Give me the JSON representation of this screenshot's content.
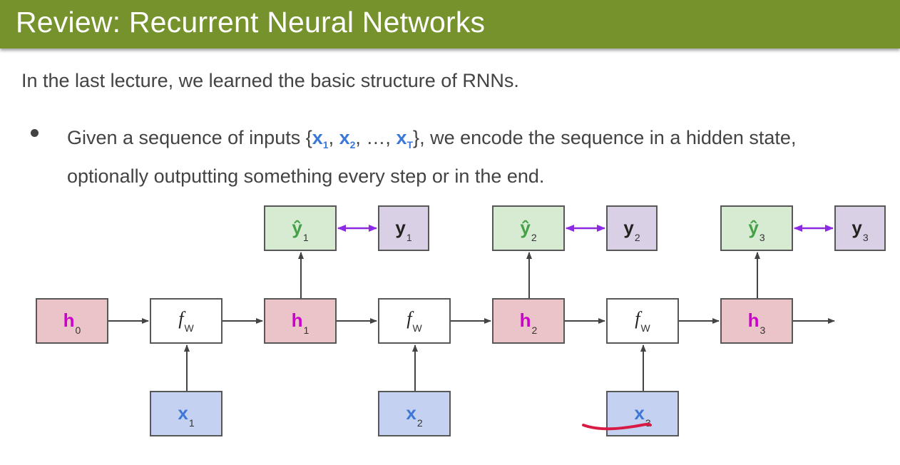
{
  "slide": {
    "title": "Review: Recurrent Neural Networks",
    "intro": "In the last lecture, we learned the basic structure of RNNs.",
    "bullet": {
      "text_before": "Given a sequence of inputs {",
      "inputs": [
        {
          "main": "x",
          "sub": "1"
        },
        {
          "main": "x",
          "sub": "2"
        },
        {
          "main": "x",
          "sub": "T"
        }
      ],
      "ellipsis": ", …,",
      "text_after": "}, we encode the sequence in a hidden state, optionally outputting something every step or in the end."
    }
  },
  "diagram": {
    "hidden": [
      {
        "main": "h",
        "sub": "0"
      },
      {
        "main": "h",
        "sub": "1"
      },
      {
        "main": "h",
        "sub": "2"
      },
      {
        "main": "h",
        "sub": "3"
      }
    ],
    "cells": [
      {
        "main": "f",
        "sub": "W"
      },
      {
        "main": "f",
        "sub": "W"
      },
      {
        "main": "f",
        "sub": "W"
      }
    ],
    "inputs": [
      {
        "main": "x",
        "sub": "1"
      },
      {
        "main": "x",
        "sub": "2"
      },
      {
        "main": "x",
        "sub": "3"
      }
    ],
    "predictions": [
      {
        "main": "ŷ",
        "sub": "1"
      },
      {
        "main": "ŷ",
        "sub": "2"
      },
      {
        "main": "ŷ",
        "sub": "3"
      }
    ],
    "targets": [
      {
        "main": "y",
        "sub": "1"
      },
      {
        "main": "y",
        "sub": "2"
      },
      {
        "main": "y",
        "sub": "3"
      }
    ],
    "colors": {
      "header_green": "#76922c",
      "hidden_fill": "#ebc4ca",
      "hidden_text": "#cc00cc",
      "input_fill": "#c5d1f0",
      "input_text": "#3c78d8",
      "prediction_fill": "#d7ebd2",
      "prediction_text": "#43a047",
      "target_fill": "#d9d0e6",
      "compare_arrow": "#8a2be2",
      "annotation_stroke": "#d81b45"
    }
  }
}
